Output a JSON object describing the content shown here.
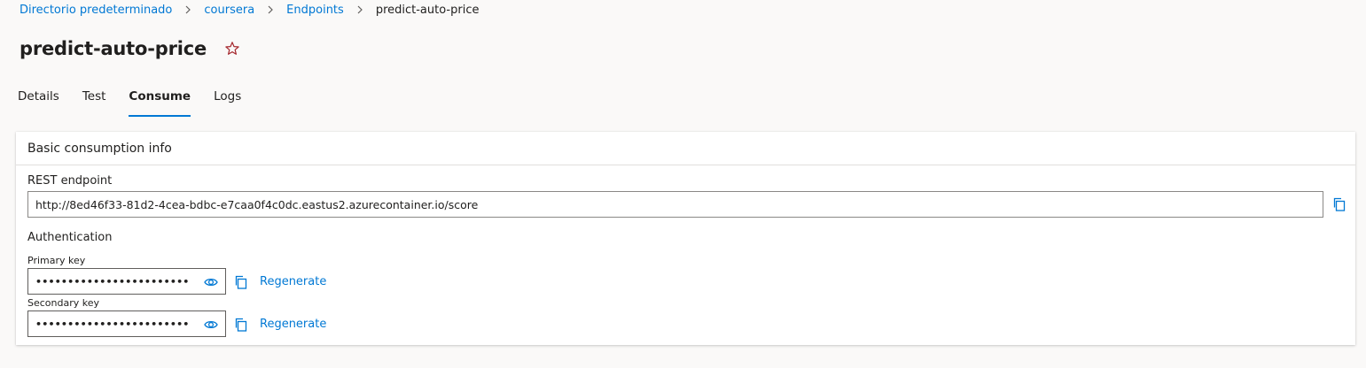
{
  "breadcrumb": {
    "items": [
      "Directorio predeterminado",
      "coursera",
      "Endpoints"
    ],
    "current": "predict-auto-price"
  },
  "header": {
    "title": "predict-auto-price"
  },
  "tabs": [
    {
      "label": "Details"
    },
    {
      "label": "Test"
    },
    {
      "label": "Consume",
      "active": true
    },
    {
      "label": "Logs"
    }
  ],
  "consume": {
    "card_title": "Basic consumption info",
    "rest_label": "REST endpoint",
    "rest_value": "http://8ed46f33-81d2-4cea-bdbc-e7caa0f4c0dc.eastus2.azurecontainer.io/score",
    "auth_label": "Authentication",
    "primary_label": "Primary key",
    "primary_value": "••••••••••••••••••••••••••••...",
    "secondary_label": "Secondary key",
    "secondary_value": "••••••••••••••••••••••••••••...",
    "regenerate_label": "Regenerate"
  },
  "icons": {
    "breadcrumb_separator": "chevron-right-icon",
    "favorite": "star-outline-icon",
    "copy": "copy-icon",
    "reveal": "eye-icon"
  },
  "colors": {
    "accent": "#0078d4",
    "star": "#a4262c"
  }
}
